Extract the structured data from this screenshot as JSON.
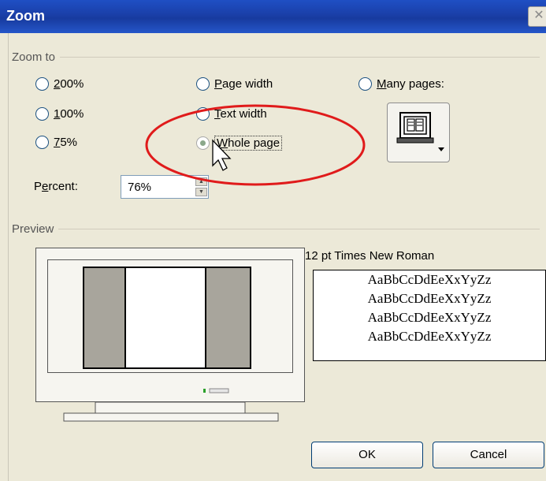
{
  "dialog": {
    "title": "Zoom",
    "close_glyph": "✕"
  },
  "zoom_to": {
    "group_label": "Zoom to",
    "options": [
      {
        "label": "200%",
        "mnemonic_index": 0,
        "checked": false
      },
      {
        "label": "100%",
        "mnemonic_index": 0,
        "checked": false
      },
      {
        "label": "75%",
        "mnemonic_index": 0,
        "checked": false
      },
      {
        "label": "Page width",
        "mnemonic_index": 0,
        "checked": false
      },
      {
        "label": "Text width",
        "mnemonic_index": 0,
        "checked": false
      },
      {
        "label": "Whole page",
        "mnemonic_index": 0,
        "checked": true
      },
      {
        "label": "Many pages:",
        "mnemonic_index": 0,
        "checked": false
      }
    ],
    "percent_label": "Percent:",
    "percent_value": "76%",
    "many_pages_icon": "multiple-pages-monitor-icon"
  },
  "preview": {
    "group_label": "Preview",
    "font_label": "12 pt Times New Roman",
    "sample_lines": [
      "AaBbCcDdEeXxYyZz",
      "AaBbCcDdEeXxYyZz",
      "AaBbCcDdEeXxYyZz",
      "AaBbCcDdEeXxYyZz"
    ]
  },
  "buttons": {
    "ok": "OK",
    "cancel": "Cancel"
  },
  "annotation": {
    "color": "#e01b1b"
  },
  "colors": {
    "titlebar": "#1f4fc4",
    "dialog_bg": "#ece9d8"
  }
}
